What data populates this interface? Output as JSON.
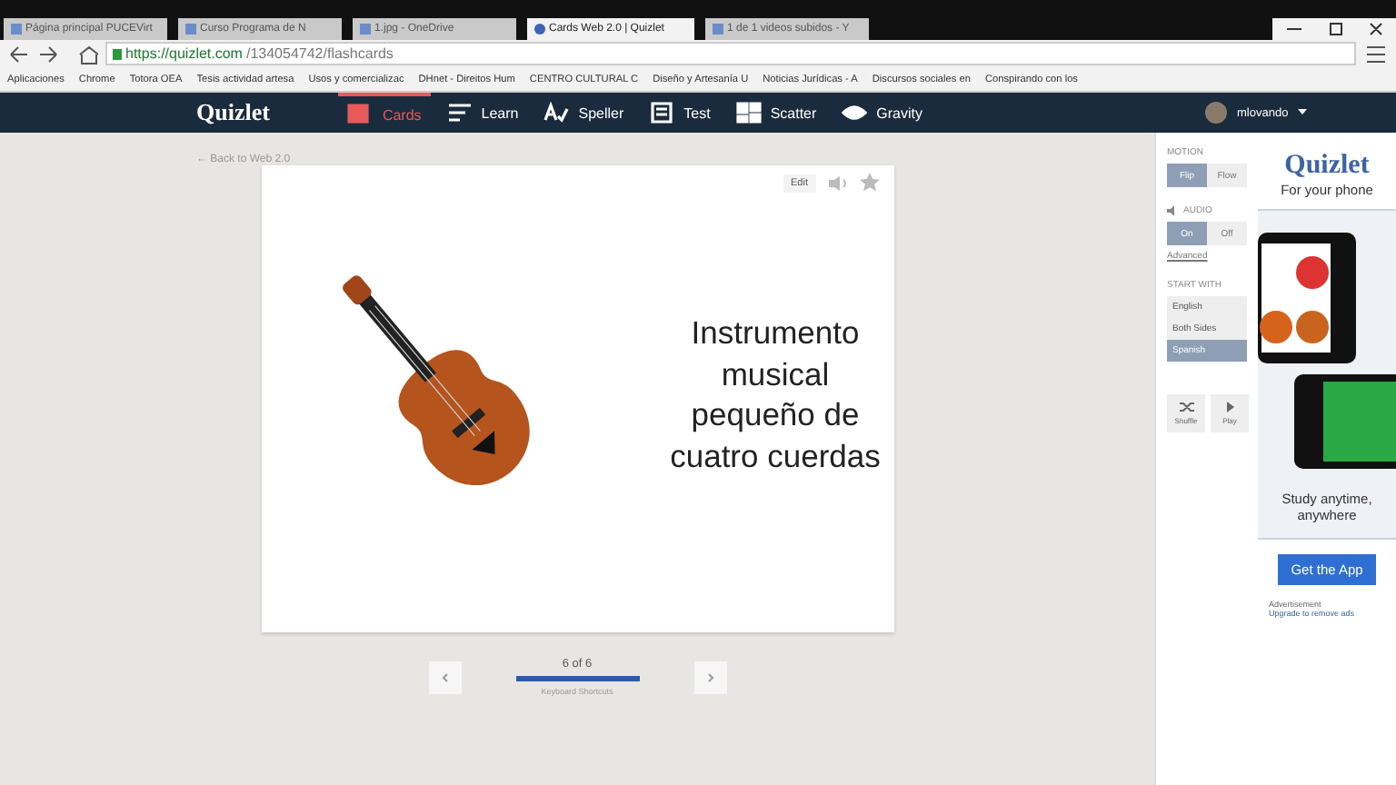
{
  "browser": {
    "tabs": [
      {
        "label": "Página principal PUCEVirt",
        "selected": false
      },
      {
        "label": "Curso Programa de N",
        "selected": false
      },
      {
        "label": "1.jpg - OneDrive",
        "selected": false
      },
      {
        "label": "Cards Web 2.0 | Quizlet",
        "selected": true
      },
      {
        "label": "1 de 1 videos subidos - Y",
        "selected": false
      }
    ],
    "url_host": "https://quizlet.com",
    "url_path": "/134054742/flashcards",
    "bookmarks": [
      "Aplicaciones",
      "Chrome",
      "Totora OEA",
      "Tesis actividad artesa",
      "Usos y comercializac",
      "DHnet - Direitos Hum",
      "CENTRO CULTURAL C",
      "Diseño y Artesanía U",
      "Noticias Jurídicas - A",
      "Discursos sociales en",
      "Conspirando con los"
    ]
  },
  "nav": {
    "logo": "Quizlet",
    "items": [
      {
        "label": "Cards",
        "kind": "cards",
        "selected": true
      },
      {
        "label": "Learn",
        "kind": "learn",
        "selected": false
      },
      {
        "label": "Speller",
        "kind": "speller",
        "selected": false
      },
      {
        "label": "Test",
        "kind": "test",
        "selected": false
      },
      {
        "label": "Scatter",
        "kind": "scatter",
        "selected": false
      },
      {
        "label": "Gravity",
        "kind": "gravity",
        "selected": false
      }
    ],
    "user": "mlovando"
  },
  "back_link": "← Back to Web 2.0",
  "card": {
    "edit": "Edit",
    "text": "Instrumento musical pequeño de cuatro cuerdas"
  },
  "pager": {
    "count": "6 of 6",
    "level": 1,
    "hint": "Keyboard Shortcuts"
  },
  "options": {
    "motion": {
      "label": "MOTION",
      "options": [
        {
          "label": "Flip",
          "selected": true
        },
        {
          "label": "Flow",
          "selected": false
        }
      ]
    },
    "audio": {
      "label": "AUDIO",
      "options": [
        {
          "label": "On",
          "selected": true
        },
        {
          "label": "Off",
          "selected": false
        }
      ],
      "link": "Advanced"
    },
    "start_with": {
      "label": "START WITH",
      "options": [
        {
          "label": "English",
          "selected": false
        },
        {
          "label": "Both Sides",
          "selected": false
        },
        {
          "label": "Spanish",
          "selected": true
        }
      ]
    },
    "actions": [
      {
        "label": "Shuffle",
        "kind": "shuffle"
      },
      {
        "label": "Play",
        "kind": "play"
      }
    ]
  },
  "ad": {
    "logo": "Quizlet",
    "tagline": "For your phone",
    "study": "Study anytime, anywhere",
    "button": "Get the App",
    "note": "Advertisement",
    "upgrade": "Upgrade to remove ads"
  }
}
